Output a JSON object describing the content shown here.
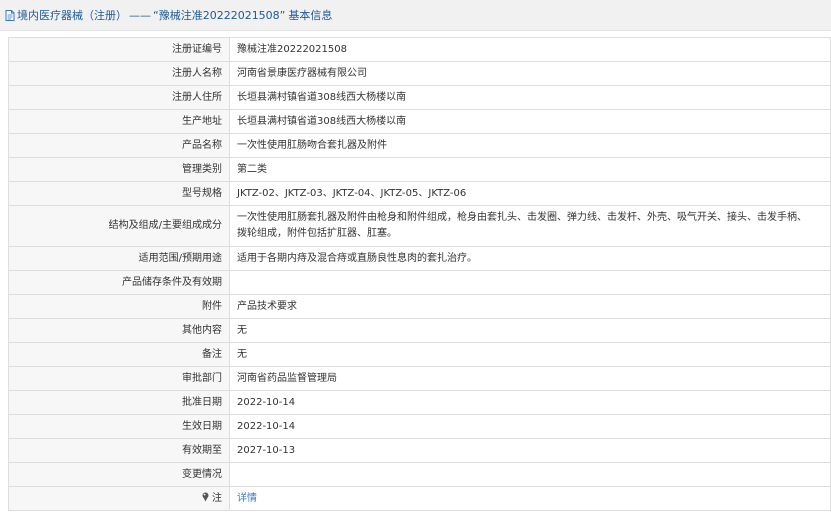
{
  "header": {
    "title": "境内医疗器械（注册）",
    "separator": "——",
    "quote": "“豫械注准20222021508”",
    "suffix": "基本信息",
    "icon": "document-icon",
    "accent_color": "#1f5a96"
  },
  "rows": [
    {
      "label": "注册证编号",
      "value": "豫械注准20222021508"
    },
    {
      "label": "注册人名称",
      "value": "河南省景康医疗器械有限公司"
    },
    {
      "label": "注册人住所",
      "value": "长垣县满村镇省道308线西大杨楼以南"
    },
    {
      "label": "生产地址",
      "value": "长垣县满村镇省道308线西大杨楼以南"
    },
    {
      "label": "产品名称",
      "value": "一次性使用肛肠吻合套扎器及附件"
    },
    {
      "label": "管理类别",
      "value": "第二类"
    },
    {
      "label": "型号规格",
      "value": "JKTZ-02、JKTZ-03、JKTZ-04、JKTZ-05、JKTZ-06"
    },
    {
      "label": "结构及组成/主要组成成分",
      "value": "一次性使用肛肠套扎器及附件由枪身和附件组成，枪身由套扎头、击发圈、弹力线、击发杆、外壳、吸气开关、接头、击发手柄、拨轮组成，附件包括扩肛器、肛塞。"
    },
    {
      "label": "适用范围/预期用途",
      "value": "适用于各期内痔及混合痔或直肠良性息肉的套扎治疗。"
    },
    {
      "label": "产品储存条件及有效期",
      "value": ""
    },
    {
      "label": "附件",
      "value": "产品技术要求"
    },
    {
      "label": "其他内容",
      "value": "无"
    },
    {
      "label": "备注",
      "value": "无"
    },
    {
      "label": "审批部门",
      "value": "河南省药品监督管理局"
    },
    {
      "label": "批准日期",
      "value": "2022-10-14"
    },
    {
      "label": "生效日期",
      "value": "2022-10-14"
    },
    {
      "label": "有效期至",
      "value": "2027-10-13"
    },
    {
      "label": "变更情况",
      "value": ""
    }
  ],
  "note_row": {
    "label": "注",
    "icon": "pin-icon",
    "link": "详情",
    "link_color": "#3a77c4"
  }
}
